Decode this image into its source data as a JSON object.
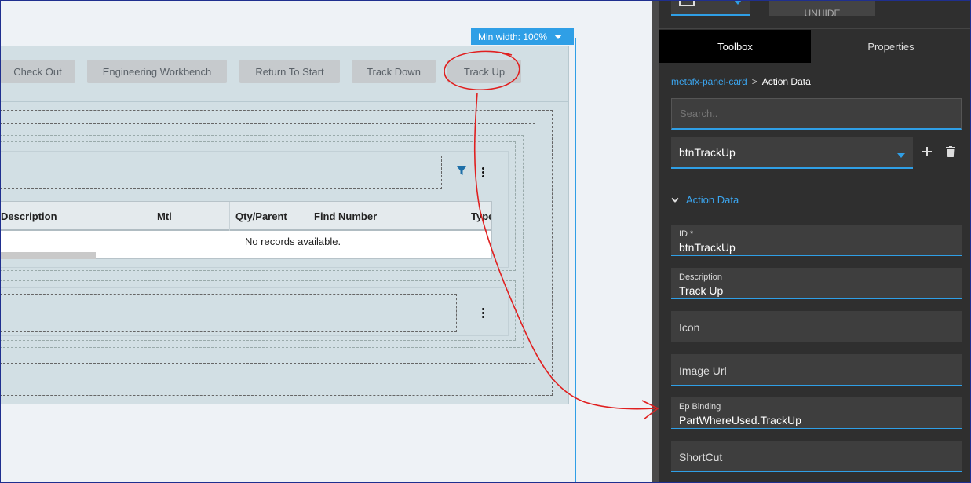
{
  "canvas": {
    "min_width_badge": "Min width: 100%",
    "toolbar_buttons": [
      "Check Out",
      "Engineering Workbench",
      "Return To Start",
      "Track Down",
      "Track Up"
    ],
    "grid": {
      "columns": [
        "Description",
        "Mtl",
        "Qty/Parent",
        "Find Number",
        "Type"
      ],
      "empty_message": "No records available."
    }
  },
  "panel": {
    "top_button": "UNHIDE",
    "tabs": [
      "Toolbox",
      "Properties"
    ],
    "breadcrumb": {
      "parent": "metafx-panel-card",
      "separator": ">",
      "current": "Action Data"
    },
    "search_placeholder": "Search..",
    "selected_action": "btnTrackUp",
    "section_title": "Action Data",
    "fields": {
      "id": {
        "label": "ID *",
        "value": "btnTrackUp"
      },
      "description": {
        "label": "Description",
        "value": "Track Up"
      },
      "icon": {
        "label": "Icon"
      },
      "image_url": {
        "label": "Image Url"
      },
      "ep_binding": {
        "label": "Ep Binding",
        "value": "PartWhereUsed.TrackUp"
      },
      "shortcut": {
        "label": "ShortCut"
      }
    }
  },
  "colors": {
    "accent": "#2f9fe6",
    "annotation": "#e02020",
    "panel_bg": "#2f2f2f"
  }
}
